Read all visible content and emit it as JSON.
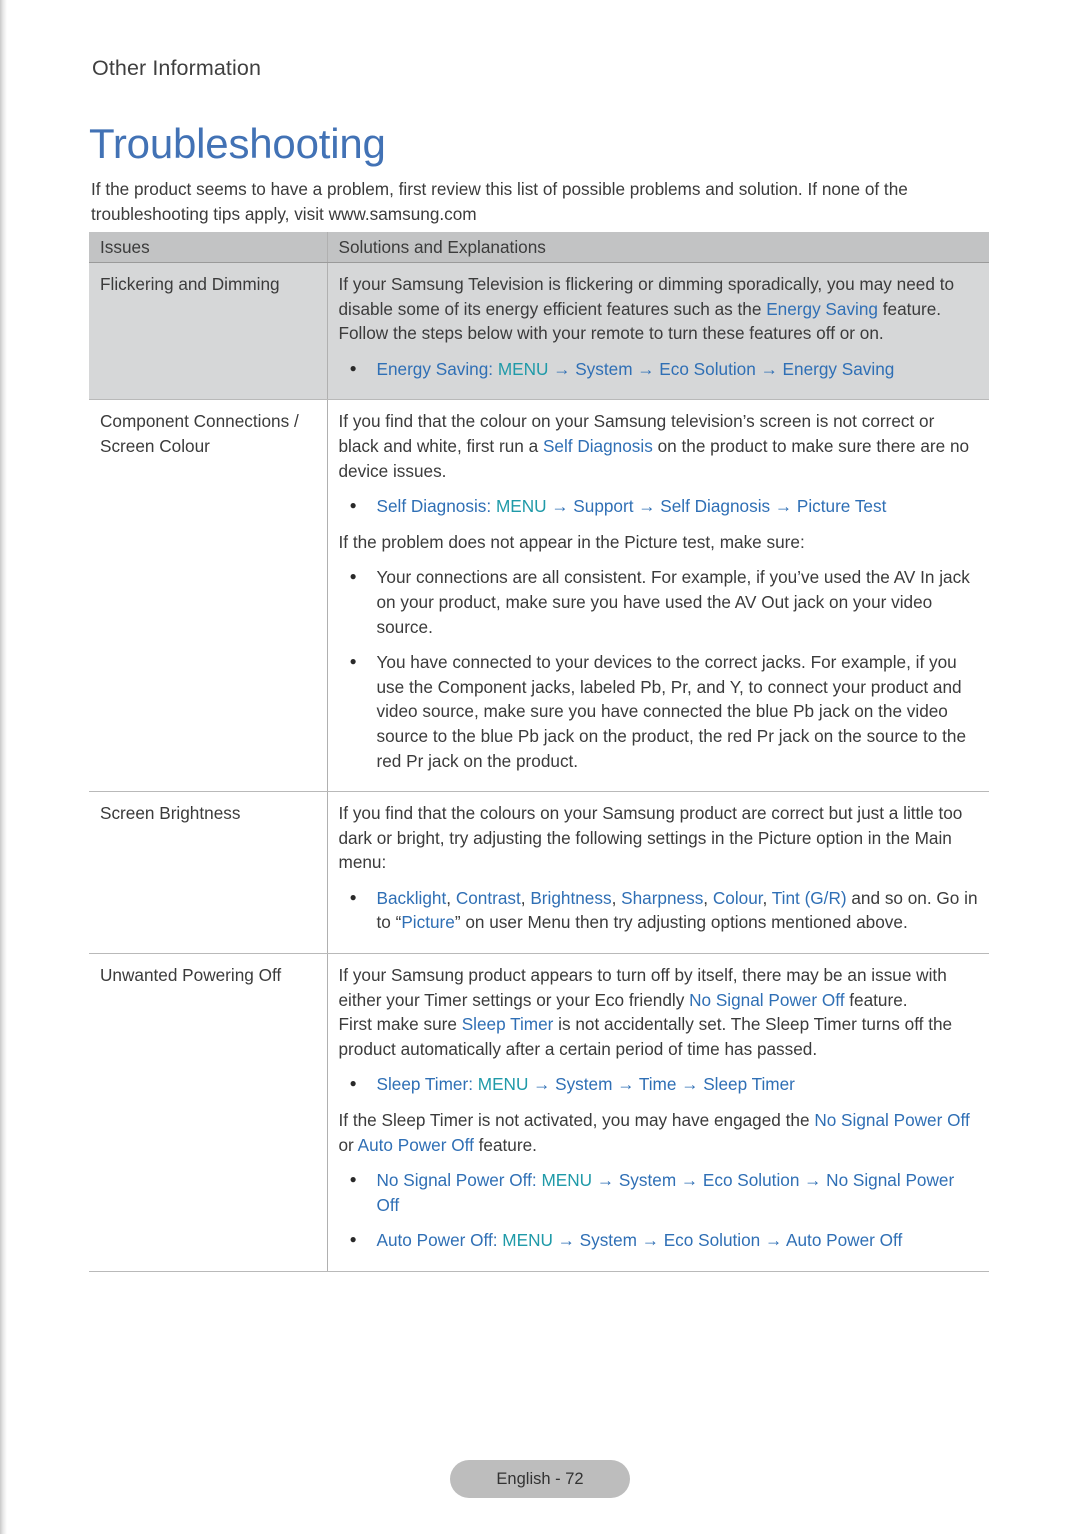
{
  "page": {
    "kicker": "Other Information",
    "title": "Troubleshooting",
    "intro": "If the product seems to have a problem, first review this list of possible problems and solution. If none of the troubleshooting tips apply, visit www.samsung.com",
    "footer_label": "English - 72",
    "colors": {
      "title_blue": "#4272b5",
      "link_blue": "#2f6fb5",
      "menu_teal": "#1f9aa8",
      "header_gray": "#c2c3c4",
      "shaded_row_gray": "#d6d7d8",
      "body_text": "#3b3b3b"
    }
  },
  "table": {
    "headers": {
      "issues": "Issues",
      "solutions": "Solutions and Explanations"
    },
    "rows": [
      {
        "issue": "Flickering and Dimming",
        "p1_a": "If your Samsung Television is flickering or dimming sporadically, you may need to disable some of its energy efficient features such as the ",
        "p1_link": "Energy Saving",
        "p1_b": " feature. Follow the steps below with your remote to turn these features off or on.",
        "b1_name": "Energy Saving",
        "b1_colon": ": ",
        "b1_menu": "MENU",
        "b1_a1": " → ",
        "b1_s1": "System",
        "b1_a2": " → ",
        "b1_s2": "Eco Solution",
        "b1_a3": " → ",
        "b1_s3": "Energy Saving"
      },
      {
        "issue_line1": "Component Connections /",
        "issue_line2": "Screen Colour",
        "p1_a": "If you find that the colour on your Samsung television’s screen is not correct or black and white, first run a ",
        "p1_link": "Self Diagnosis",
        "p1_b": " on the product to make sure there are no device issues.",
        "b1_name": "Self Diagnosis",
        "b1_colon": ": ",
        "b1_menu": "MENU",
        "b1_a1": " → ",
        "b1_s1": "Support",
        "b1_a2": " → ",
        "b1_s2": "Self Diagnosis",
        "b1_a3": " → ",
        "b1_s3": "Picture Test",
        "p2": "If the problem does not appear in the Picture test, make sure:",
        "b2": "Your connections are all consistent. For example, if you’ve used the AV In jack on your product, make sure you have used the AV Out jack on your video source.",
        "b3": "You have connected to your devices to the correct jacks. For example, if you use the Component jacks, labeled Pb, Pr, and Y, to connect your product and video source, make sure you have connected the blue Pb jack on the video source to the blue Pb jack on the product, the red Pr jack on the source to the red Pr jack on the product."
      },
      {
        "issue": "Screen Brightness",
        "p1": "If you find that the colours on your Samsung product are correct but just a little too dark or bright, try adjusting the following settings in the Picture option in the Main menu:",
        "b1_l1": "Backlight",
        "b1_c1": ", ",
        "b1_l2": "Contrast",
        "b1_c2": ", ",
        "b1_l3": "Brightness",
        "b1_c3": ", ",
        "b1_l4": "Sharpness",
        "b1_c4": ", ",
        "b1_l5": "Colour",
        "b1_c5": ", ",
        "b1_l6": "Tint (G/R)",
        "b1_tail": " and so on. Go in to “",
        "b1_l7": "Picture",
        "b1_tail2": "” on user Menu then try adjusting options mentioned above."
      },
      {
        "issue": "Unwanted Powering Off",
        "p1_a": "If your Samsung product appears to turn off by itself, there may be an issue with either your Timer settings or your Eco friendly ",
        "p1_link": "No Signal Power Off",
        "p1_b": " feature.",
        "p2_a": "First make sure ",
        "p2_link": "Sleep Timer",
        "p2_b": " is not accidentally set. The Sleep Timer turns off the product automatically after a certain period of time has passed.",
        "b1_name": "Sleep Timer",
        "b1_colon": ": ",
        "b1_menu": "MENU",
        "b1_a1": " → ",
        "b1_s1": "System",
        "b1_a2": " → ",
        "b1_s2": "Time",
        "b1_a3": " → ",
        "b1_s3": "Sleep Timer",
        "p3_a": "If the Sleep Timer is not activated, you may have engaged the ",
        "p3_link1": "No Signal Power Off",
        "p3_mid": " or ",
        "p3_link2": "Auto Power Off",
        "p3_b": " feature.",
        "b2_name": "No Signal Power Off",
        "b2_colon": ": ",
        "b2_menu": "MENU",
        "b2_a1": " → ",
        "b2_s1": "System",
        "b2_a2": " → ",
        "b2_s2": "Eco Solution",
        "b2_a3": " → ",
        "b2_s3": "No Signal Power Off",
        "b3_name": "Auto Power Off",
        "b3_colon": ": ",
        "b3_menu": "MENU",
        "b3_a1": " → ",
        "b3_s1": "System",
        "b3_a2": " → ",
        "b3_s2": "Eco Solution",
        "b3_a3": " → ",
        "b3_s3": "Auto Power Off"
      }
    ]
  }
}
